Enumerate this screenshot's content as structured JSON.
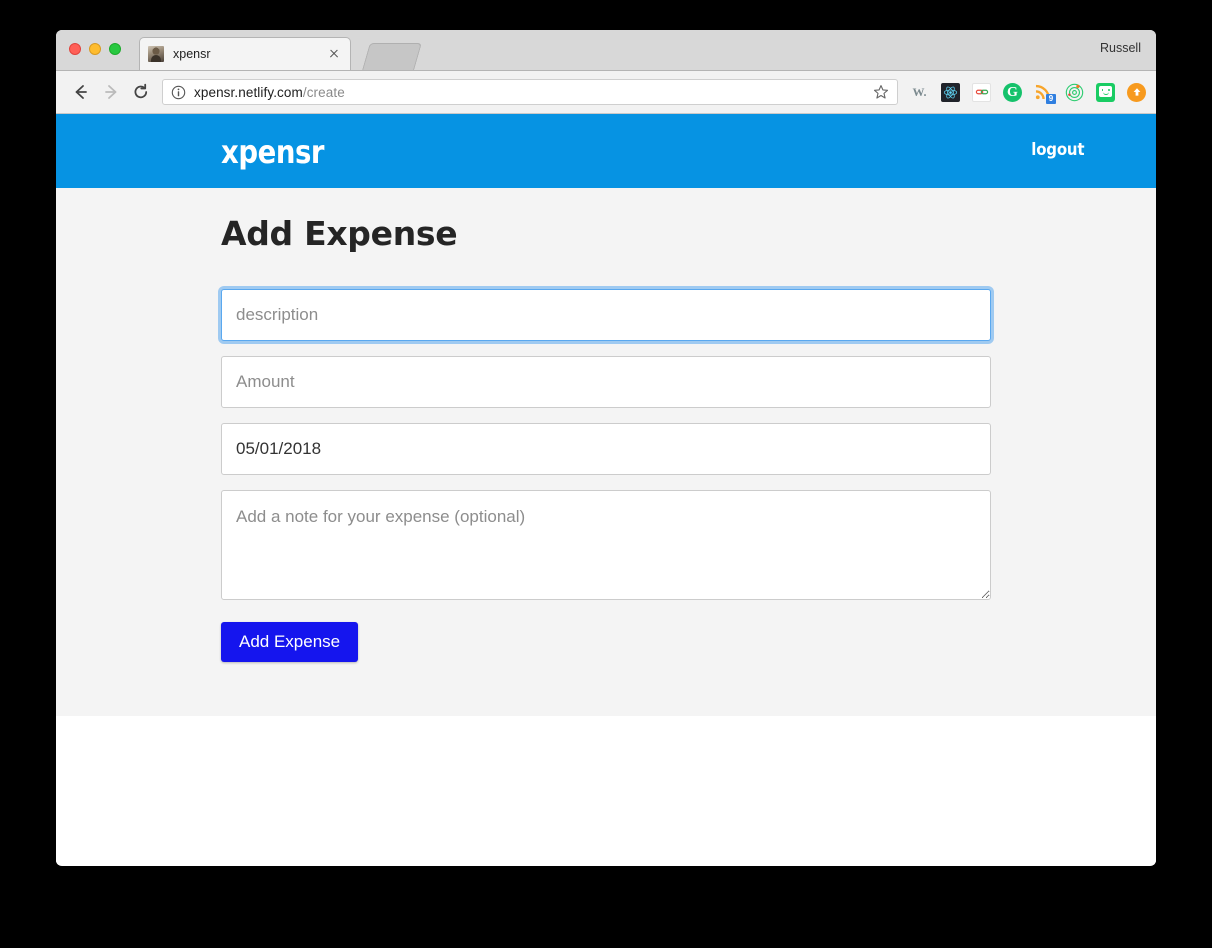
{
  "browser": {
    "profile_name": "Russell",
    "tab": {
      "title": "xpensr",
      "favicon_name": "site-favicon",
      "close_label": "×"
    },
    "toolbar": {
      "back_icon": "back-arrow-icon",
      "forward_icon": "forward-arrow-icon",
      "reload_icon": "reload-icon",
      "security_icon": "info-circle-icon",
      "url_domain": "xpensr.netlify.com",
      "url_path": "/create",
      "bookmark_icon": "star-icon"
    },
    "extensions": [
      {
        "name": "wikiwand-extension-icon",
        "label": "W."
      },
      {
        "name": "react-devtools-extension-icon",
        "label": ""
      },
      {
        "name": "link-extension-icon",
        "label": ""
      },
      {
        "name": "grammarly-extension-icon",
        "label": "G"
      },
      {
        "name": "rss-feed-extension-icon",
        "label": "",
        "badge": "9"
      },
      {
        "name": "radar-extension-icon",
        "label": ""
      },
      {
        "name": "chat-extension-icon",
        "label": ""
      },
      {
        "name": "upload-extension-icon",
        "label": ""
      }
    ]
  },
  "site": {
    "logo": "xpensr",
    "logout_label": "logout",
    "header_color": "#0693e3"
  },
  "page": {
    "title": "Add Expense",
    "form": {
      "description": {
        "placeholder": "description",
        "value": "",
        "focused": true
      },
      "amount": {
        "placeholder": "Amount",
        "value": ""
      },
      "date": {
        "placeholder": "",
        "value": "05/01/2018"
      },
      "note": {
        "placeholder": "Add a note for your expense (optional)",
        "value": ""
      },
      "submit_label": "Add Expense",
      "submit_color": "#1515ee"
    }
  }
}
